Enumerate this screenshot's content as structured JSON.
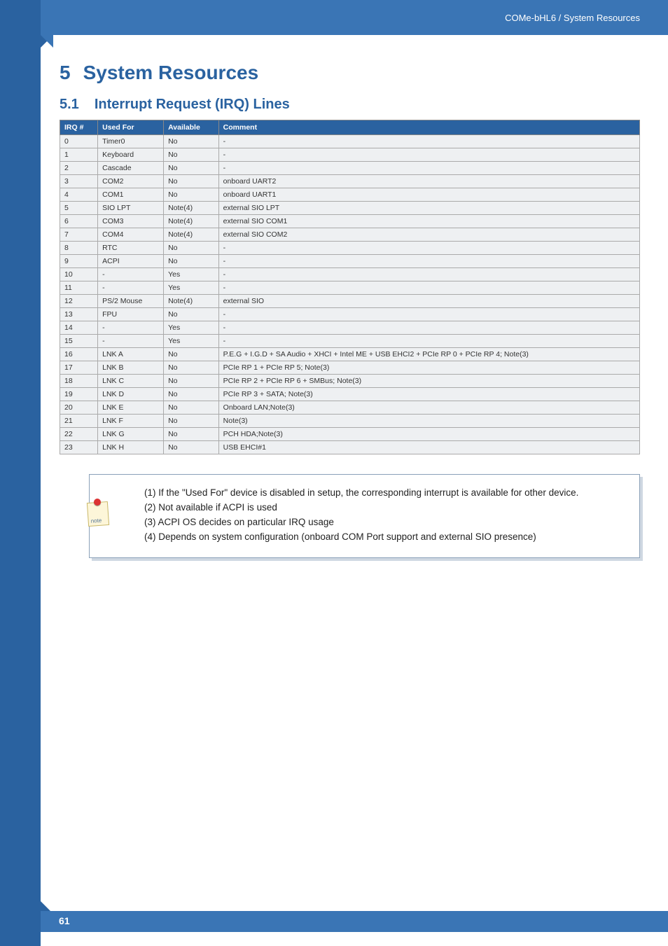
{
  "header": {
    "breadcrumb": "COMe-bHL6 / System Resources"
  },
  "chapter": {
    "number": "5",
    "title": "System Resources"
  },
  "section": {
    "number": "5.1",
    "title": "Interrupt Request (IRQ) Lines"
  },
  "table": {
    "headers": {
      "irq": "IRQ #",
      "used_for": "Used For",
      "available": "Available",
      "comment": "Comment"
    },
    "rows": [
      {
        "irq": "0",
        "used_for": "Timer0",
        "available": "No",
        "comment": "-"
      },
      {
        "irq": "1",
        "used_for": "Keyboard",
        "available": "No",
        "comment": "-"
      },
      {
        "irq": "2",
        "used_for": "Cascade",
        "available": "No",
        "comment": "-"
      },
      {
        "irq": "3",
        "used_for": "COM2",
        "available": "No",
        "comment": "onboard UART2"
      },
      {
        "irq": "4",
        "used_for": "COM1",
        "available": "No",
        "comment": "onboard UART1"
      },
      {
        "irq": "5",
        "used_for": "SIO LPT",
        "available": "Note(4)",
        "comment": "external SIO LPT"
      },
      {
        "irq": "6",
        "used_for": "COM3",
        "available": "Note(4)",
        "comment": "external SIO COM1"
      },
      {
        "irq": "7",
        "used_for": "COM4",
        "available": "Note(4)",
        "comment": "external SIO COM2"
      },
      {
        "irq": "8",
        "used_for": "RTC",
        "available": "No",
        "comment": "-"
      },
      {
        "irq": "9",
        "used_for": "ACPI",
        "available": "No",
        "comment": "-"
      },
      {
        "irq": "10",
        "used_for": "-",
        "available": "Yes",
        "comment": "-"
      },
      {
        "irq": "11",
        "used_for": "-",
        "available": "Yes",
        "comment": "-"
      },
      {
        "irq": "12",
        "used_for": "PS/2 Mouse",
        "available": "Note(4)",
        "comment": "external SIO"
      },
      {
        "irq": "13",
        "used_for": "FPU",
        "available": "No",
        "comment": "-"
      },
      {
        "irq": "14",
        "used_for": "-",
        "available": "Yes",
        "comment": "-"
      },
      {
        "irq": "15",
        "used_for": "-",
        "available": "Yes",
        "comment": "-"
      },
      {
        "irq": "16",
        "used_for": "LNK A",
        "available": "No",
        "comment": "P.E.G + I.G.D + SA Audio + XHCI + Intel ME + USB EHCI2 + PCIe RP 0 + PCIe RP 4; Note(3)"
      },
      {
        "irq": "17",
        "used_for": "LNK B",
        "available": "No",
        "comment": "PCIe RP 1 + PCIe RP 5; Note(3)"
      },
      {
        "irq": "18",
        "used_for": "LNK C",
        "available": "No",
        "comment": "PCIe RP 2 + PCIe RP 6 + SMBus; Note(3)"
      },
      {
        "irq": "19",
        "used_for": "LNK D",
        "available": "No",
        "comment": "PCIe RP 3 + SATA; Note(3)"
      },
      {
        "irq": "20",
        "used_for": "LNK E",
        "available": "No",
        "comment": "Onboard LAN;Note(3)"
      },
      {
        "irq": "21",
        "used_for": "LNK F",
        "available": "No",
        "comment": "Note(3)"
      },
      {
        "irq": "22",
        "used_for": "LNK G",
        "available": "No",
        "comment": "PCH HDA;Note(3)"
      },
      {
        "irq": "23",
        "used_for": "LNK H",
        "available": "No",
        "comment": "USB EHCI#1"
      }
    ]
  },
  "notes": [
    "(1) If the \"Used For\" device is disabled in setup, the corresponding interrupt is available for other device.",
    "(2) Not available if ACPI is used",
    "(3) ACPI OS decides on particular IRQ usage",
    "(4) Depends on system configuration (onboard COM Port support and external SIO presence)"
  ],
  "page_number": "61"
}
